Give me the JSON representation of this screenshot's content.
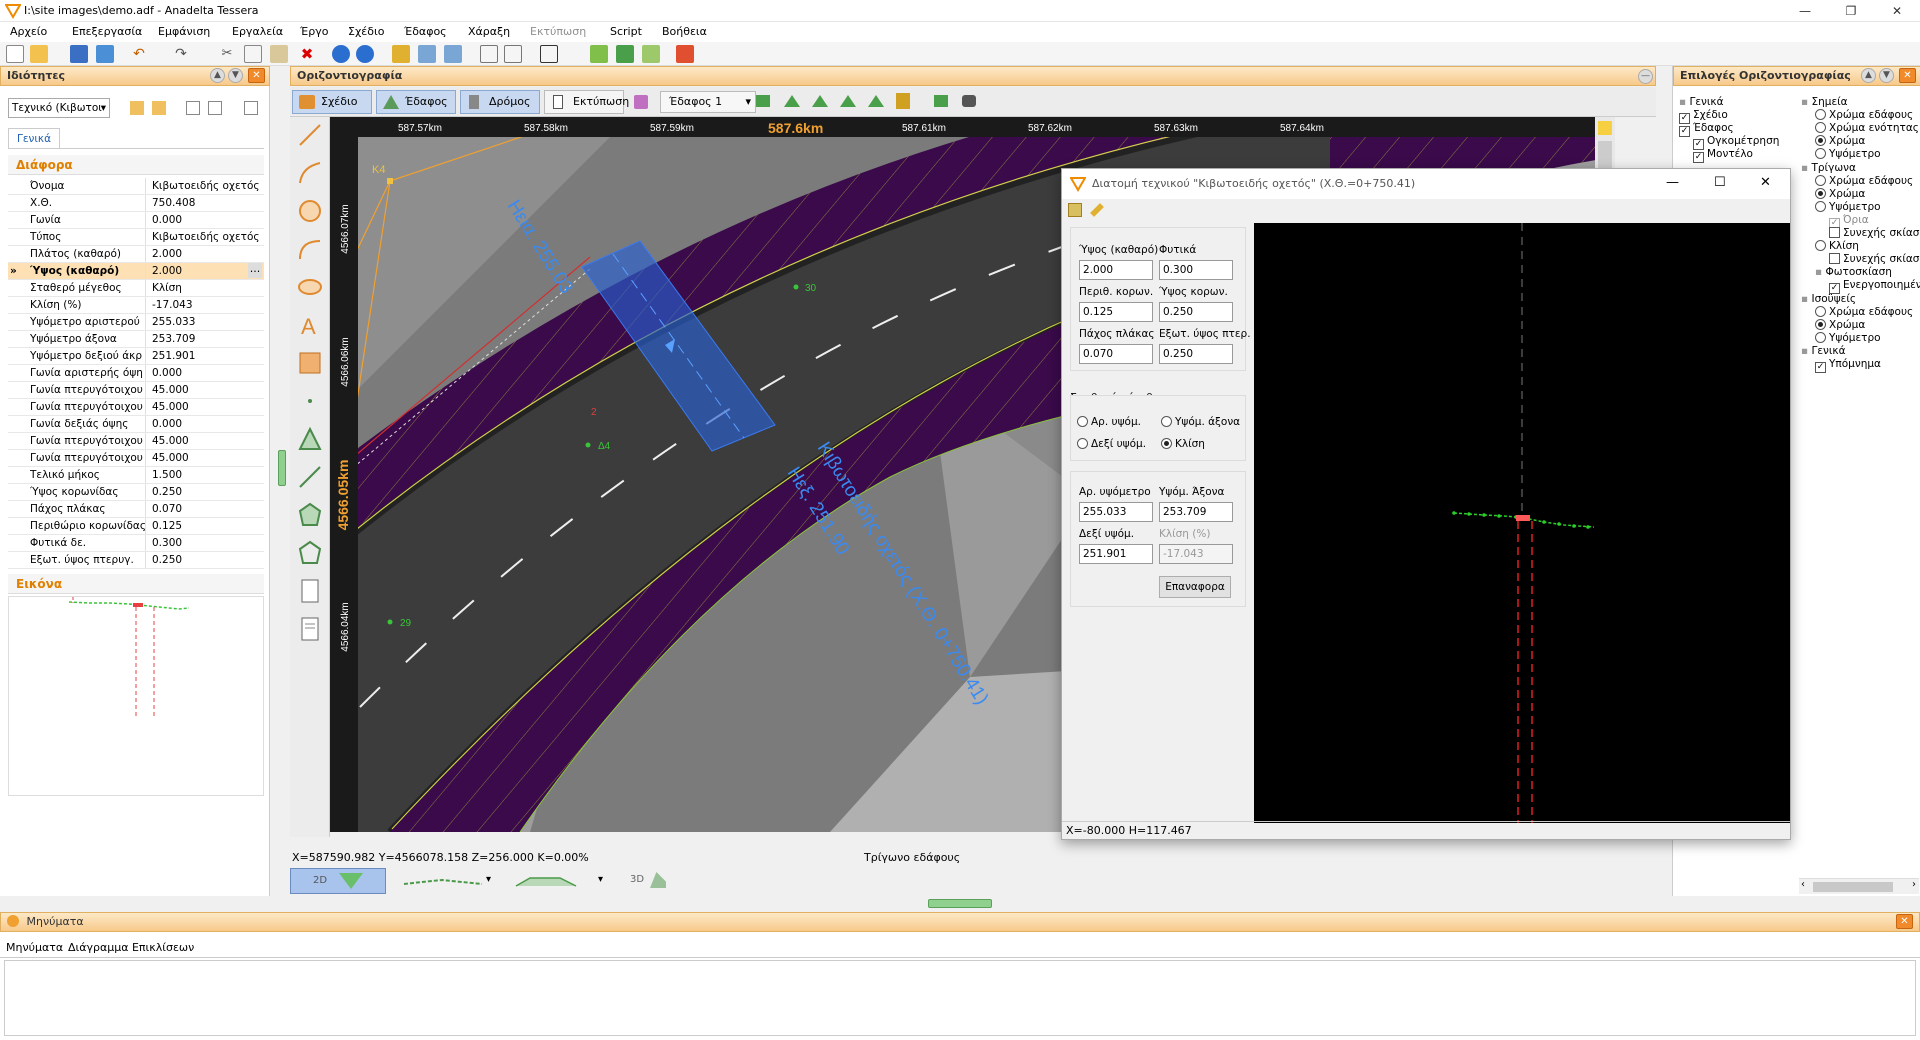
{
  "window": {
    "title": "I:\\site images\\demo.adf - Anadelta Tessera"
  },
  "menu": [
    "Αρχείο",
    "Επεξεργασία",
    "Εμφάνιση",
    "Εργαλεία",
    "Έργο",
    "Σχέδιο",
    "Έδαφος",
    "Χάραξη",
    "Εκτύπωση",
    "Script",
    "Βοήθεια"
  ],
  "properties": {
    "title": "Ιδιότητες",
    "object_select": "Τεχνικό (Κιβωτοι",
    "tab": "Γενικά",
    "section": "Διάφορα",
    "rows": [
      {
        "k": "Όνομα",
        "v": "Κιβωτοειδής οχετός"
      },
      {
        "k": "Χ.Θ.",
        "v": "750.408"
      },
      {
        "k": "Γωνία",
        "v": "0.000"
      },
      {
        "k": "Τύπος",
        "v": "Κιβωτοειδής οχετός"
      },
      {
        "k": "Πλάτος (καθαρό)",
        "v": "2.000"
      },
      {
        "k": "Ύψος (καθαρό)",
        "v": "2.000"
      },
      {
        "k": "Σταθερό μέγεθος",
        "v": "Κλίση"
      },
      {
        "k": "Κλίση (%)",
        "v": "-17.043"
      },
      {
        "k": "Υψόμετρο αριστερού",
        "v": "255.033"
      },
      {
        "k": "Υψόμετρο άξονα",
        "v": "253.709"
      },
      {
        "k": "Υψόμετρο δεξιού άκρ",
        "v": "251.901"
      },
      {
        "k": "Γωνία αριστερής όψη",
        "v": "0.000"
      },
      {
        "k": "Γωνία πτερυγότοιχου",
        "v": "45.000"
      },
      {
        "k": "Γωνία πτερυγότοιχου",
        "v": "45.000"
      },
      {
        "k": "Γωνία δεξιάς όψης",
        "v": "0.000"
      },
      {
        "k": "Γωνία πτερυγότοιχου",
        "v": "45.000"
      },
      {
        "k": "Γωνία πτερυγότοιχου",
        "v": "45.000"
      },
      {
        "k": "Τελικό μήκος",
        "v": "1.500"
      },
      {
        "k": "Ύψος κορωνίδας",
        "v": "0.250"
      },
      {
        "k": "Πάχος πλάκας",
        "v": "0.070"
      },
      {
        "k": "Περιθώριο κορωνίδας",
        "v": "0.125"
      },
      {
        "k": "Φυτικά δε.",
        "v": "0.300"
      },
      {
        "k": "Εξωτ. ύψος πτερυγ.",
        "v": "0.250"
      }
    ],
    "selected_index": 5,
    "image_section": "Εικόνα"
  },
  "view": {
    "title": "Οριζοντιογραφία",
    "tabs": [
      "Σχέδιο",
      "Έδαφος",
      "Δρόμος",
      "Εκτύπωση"
    ],
    "ground_select": "Έδαφος 1",
    "x_ticks": [
      "587.57km",
      "587.58km",
      "587.59km",
      "587.6km",
      "587.61km",
      "587.62km",
      "587.63km",
      "587.64km"
    ],
    "y_ticks": [
      "4566.07km",
      "4566.06km",
      "4566.05km",
      "4566.04km"
    ],
    "labels": {
      "k4": "K4",
      "p30": "30",
      "p29": "29",
      "d4": "Δ4",
      "n2": "2",
      "left_elev": "Hεια. 255.03",
      "right_elev": "Hεξ. 251.90",
      "culvert": "Κιβωτοειδής οχετός (Χ.Θ. 0+750.41)"
    },
    "status": "X=587590.982  Y=4566078.158  Z=256.000  K=0.00%",
    "status_right": "Τρίγωνο εδάφους",
    "bottom_tabs": [
      "2D",
      "3D"
    ]
  },
  "right_panel": {
    "title": "Επιλογές Οριζοντιογραφίας",
    "left_tree": [
      {
        "t": "Γενικά",
        "type": "group",
        "d": 0
      },
      {
        "t": "Σχέδιο",
        "type": "cb",
        "on": true,
        "d": 0
      },
      {
        "t": "Έδαφος",
        "type": "cb",
        "on": true,
        "d": 0
      },
      {
        "t": "Ογκομέτρηση",
        "type": "cb",
        "on": true,
        "d": 1
      },
      {
        "t": "Μοντέλο",
        "type": "cb",
        "on": true,
        "d": 1
      }
    ],
    "right_tree": [
      {
        "t": "Σημεία",
        "type": "group",
        "d": 0
      },
      {
        "t": "Χρώμα εδάφους",
        "type": "rb",
        "on": false,
        "d": 1
      },
      {
        "t": "Χρώμα ενότητας",
        "type": "rb",
        "on": false,
        "d": 1
      },
      {
        "t": "Χρώμα",
        "type": "rb",
        "on": true,
        "d": 1
      },
      {
        "t": "Υψόμετρο",
        "type": "rb",
        "on": false,
        "d": 1
      },
      {
        "t": "Τρίγωνα",
        "type": "group",
        "d": 0
      },
      {
        "t": "Χρώμα εδάφους",
        "type": "rb",
        "on": false,
        "d": 1
      },
      {
        "t": "Χρώμα",
        "type": "rb",
        "on": true,
        "d": 1
      },
      {
        "t": "Υψόμετρο",
        "type": "rb",
        "on": false,
        "d": 1
      },
      {
        "t": "Όρια",
        "type": "cb",
        "on": true,
        "dis": true,
        "d": 2
      },
      {
        "t": "Συνεχής σκίαση",
        "type": "cb",
        "on": false,
        "d": 2
      },
      {
        "t": "Κλίση",
        "type": "rb",
        "on": false,
        "d": 1
      },
      {
        "t": "Συνεχής σκίαση",
        "type": "cb",
        "on": false,
        "d": 2
      },
      {
        "t": "Φωτοσκίαση",
        "type": "group",
        "d": 1
      },
      {
        "t": "Ενεργοποιημένη",
        "type": "cb",
        "on": true,
        "d": 2
      },
      {
        "t": "Ισοϋψείς",
        "type": "group",
        "d": 0
      },
      {
        "t": "Χρώμα εδάφους",
        "type": "rb",
        "on": false,
        "d": 1
      },
      {
        "t": "Χρώμα",
        "type": "rb",
        "on": true,
        "d": 1
      },
      {
        "t": "Υψόμετρο",
        "type": "rb",
        "on": false,
        "d": 1
      },
      {
        "t": "Γενικά",
        "type": "group",
        "d": 0
      },
      {
        "t": "Υπόμνημα",
        "type": "cb",
        "on": true,
        "d": 1
      }
    ]
  },
  "messages": {
    "title": "Μηνύματα",
    "tabs": [
      "Μηνύματα",
      "Διάγραμμα Επικλίσεων"
    ]
  },
  "dialog": {
    "title": "Διατομή τεχνικού  \"Κιβωτοειδής οχετός\" (Χ.Θ.=0+750.41)",
    "f": {
      "height_label": "Ύψος (καθαρό)",
      "height": "2.000",
      "plant_label": "Φυτικά",
      "plant": "0.300",
      "crown_margin_label": "Περιθ. κορων.",
      "crown_margin": "0.125",
      "crown_height_label": "Ύψος κορων.",
      "crown_height": "0.250",
      "slab_label": "Πάχος πλάκας",
      "slab": "0.070",
      "wing_label": "Εξωτ. ύψος πτερ.",
      "wing": "0.250"
    },
    "fixed_size": {
      "label": "Σταθερό μέγεθος",
      "opts": [
        "Αρ. υψόμ.",
        "Υψόμ. άξονα",
        "Δεξί υψόμ.",
        "Κλίση"
      ],
      "selected": 3
    },
    "elev": {
      "left_label": "Αρ. υψόμετρο",
      "left": "255.033",
      "axis_label": "Υψόμ. Άξονα",
      "axis": "253.709",
      "right_label": "Δεξί υψόμ.",
      "right": "251.901",
      "slope_label": "Κλίση (%)",
      "slope": "-17.043"
    },
    "reset_button": "Επαναφορα",
    "status": "X=-80.000  H=117.467"
  }
}
